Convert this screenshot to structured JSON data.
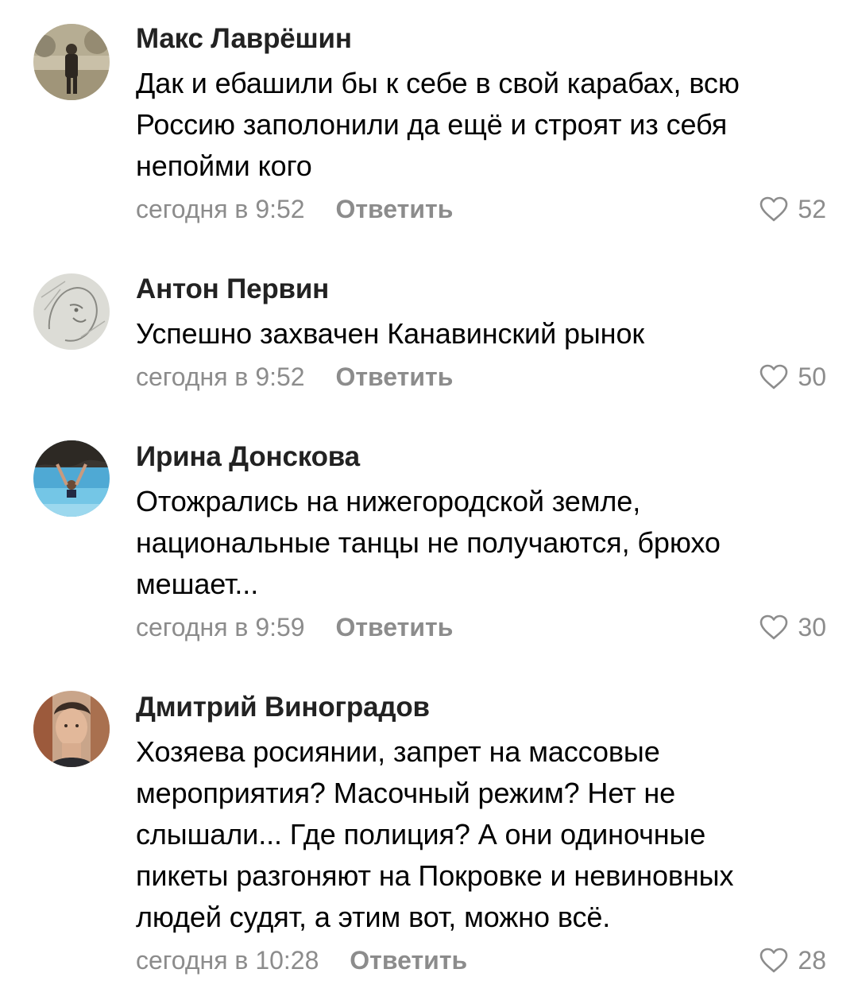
{
  "comments": [
    {
      "author": "Макс Лаврёшин",
      "text": "Дак и ебашили бы к себе в свой карабах, всю\nРоссию заполонили да ещё и строят из себя\nнепойми кого",
      "time": "сегодня в 9:52",
      "reply_label": "Ответить",
      "likes": "52",
      "avatar": "avatar-photo-man-outdoors"
    },
    {
      "author": "Антон Первин",
      "text": "Успешно захвачен Канавинский рынок",
      "time": "сегодня в 9:52",
      "reply_label": "Ответить",
      "likes": "50",
      "avatar": "avatar-pencil-sketch"
    },
    {
      "author": "Ирина Донскова",
      "text": "Отожрались на нижегородской земле,\nнациональные танцы не получаются, брюхо\nмешает...",
      "time": "сегодня в 9:59",
      "reply_label": "Ответить",
      "likes": "30",
      "avatar": "avatar-photo-sea"
    },
    {
      "author": "Дмитрий Виноградов",
      "text": "Хозяева росиянии, запрет на массовые\nмероприятия? Масочный режим? Нет не\nслышали... Где полиция? А они одиночные\nпикеты разгоняют на Покровке и невиновных\nлюдей судят, а этим вот, можно всё.",
      "time": "сегодня в 10:28",
      "reply_label": "Ответить",
      "likes": "28",
      "avatar": "avatar-photo-portrait"
    }
  ],
  "icons": {
    "like": "heart-outline-icon"
  },
  "colors": {
    "meta_gray": "#8c8c8c",
    "author": "#222222",
    "text": "#000000",
    "background": "#ffffff"
  }
}
